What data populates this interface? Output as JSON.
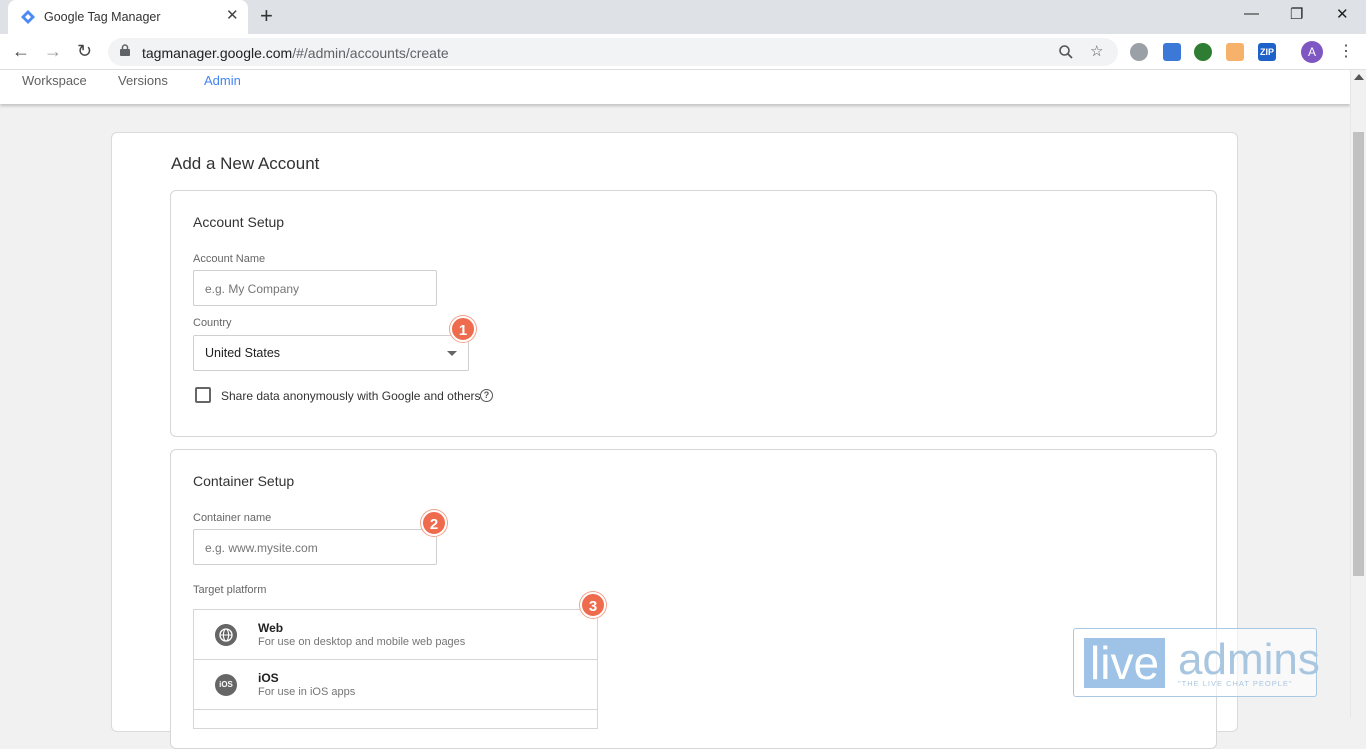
{
  "browser": {
    "tab_title": "Google Tag Manager",
    "tab_close": "✕",
    "new_tab": "+",
    "window_controls": [
      "—",
      "❐",
      "✕"
    ],
    "url_host": "tagmanager.google.com",
    "url_path": "/#/admin/accounts/create",
    "avatar_letter": "A",
    "extensions": [
      "globe-icon",
      "page-translate-icon",
      "earth-icon",
      "color-picker-icon",
      "zip-icon"
    ],
    "ext_zip_label": "ZIP"
  },
  "app_nav": {
    "tabs": [
      {
        "label": "Workspace",
        "active": false
      },
      {
        "label": "Versions",
        "active": false
      },
      {
        "label": "Admin",
        "active": true
      }
    ]
  },
  "form": {
    "title": "Add a New Account",
    "account_setup": {
      "heading": "Account Setup",
      "account_name_label": "Account Name",
      "account_name_placeholder": "e.g. My Company",
      "country_label": "Country",
      "country_value": "United States",
      "share_label": "Share data anonymously with Google and others",
      "share_checked": false,
      "help_glyph": "?"
    },
    "container_setup": {
      "heading": "Container Setup",
      "container_name_label": "Container name",
      "container_name_placeholder": "e.g. www.mysite.com",
      "target_platform_label": "Target platform",
      "platforms": [
        {
          "name": "Web",
          "description": "For use on desktop and mobile web pages",
          "icon": "globe-icon"
        },
        {
          "name": "iOS",
          "description": "For use in iOS apps",
          "icon": "ios-icon",
          "icon_text": "iOS"
        }
      ]
    }
  },
  "annotations": [
    "1",
    "2",
    "3"
  ],
  "watermark": {
    "word1": "live",
    "word2": "admins",
    "tagline": "\"THE LIVE CHAT PEOPLE\""
  },
  "colors": {
    "accent": "#4285f4",
    "badge": "#ee6c4d",
    "avatar": "#7e57c2"
  }
}
